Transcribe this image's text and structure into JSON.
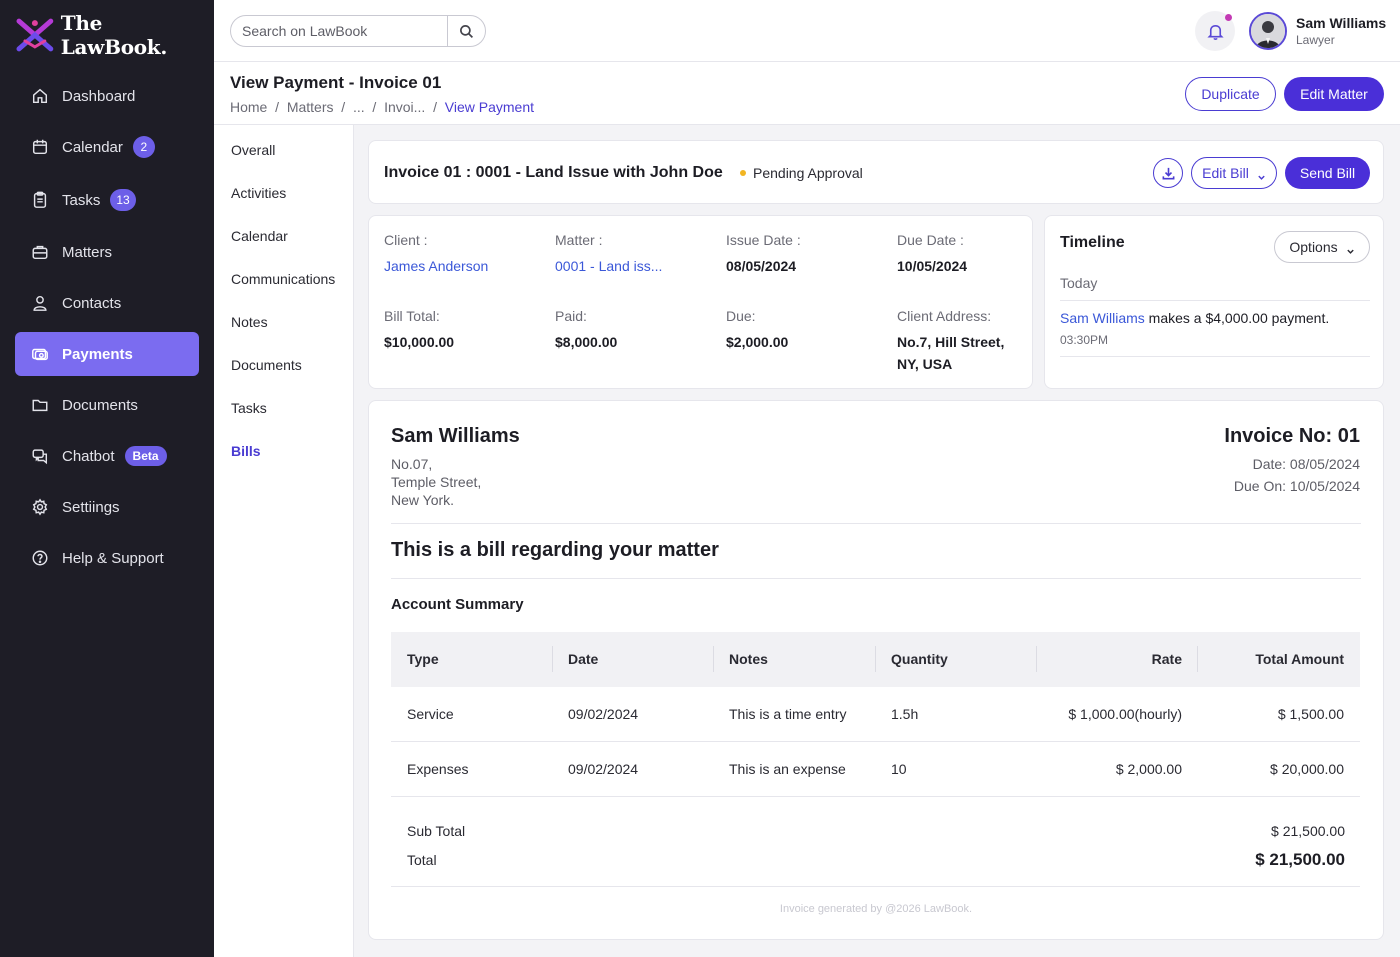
{
  "app": {
    "name": "The LawBook."
  },
  "colors": {
    "accent": "#4a2fd8",
    "sidebar_bg": "#1e1d26",
    "active_nav": "#7b6cf0",
    "link": "#3b58d8",
    "pending": "#f2b522"
  },
  "sidebar": {
    "items": [
      {
        "label": "Dashboard",
        "icon": "home-icon"
      },
      {
        "label": "Calendar",
        "icon": "calendar-icon",
        "badge": "2"
      },
      {
        "label": "Tasks",
        "icon": "clipboard-icon",
        "badge": "13"
      },
      {
        "label": "Matters",
        "icon": "briefcase-icon"
      },
      {
        "label": "Contacts",
        "icon": "user-icon"
      },
      {
        "label": "Payments",
        "icon": "payments-icon",
        "active": true
      },
      {
        "label": "Documents",
        "icon": "folder-icon"
      },
      {
        "label": "Chatbot",
        "icon": "chat-icon",
        "badge": "Beta"
      },
      {
        "label": "Settiings",
        "icon": "gear-icon"
      },
      {
        "label": "Help & Support",
        "icon": "help-icon"
      }
    ]
  },
  "search": {
    "placeholder": "Search on LawBook"
  },
  "user": {
    "name": "Sam Williams",
    "role": "Lawyer"
  },
  "page": {
    "title": "View Payment - Invoice 01",
    "breadcrumb": [
      "Home",
      "Matters",
      "...",
      "Invoi...",
      "View Payment"
    ],
    "duplicate_label": "Duplicate",
    "edit_matter_label": "Edit Matter"
  },
  "subnav": {
    "items": [
      "Overall",
      "Activities",
      "Calendar",
      "Communications",
      "Notes",
      "Documents",
      "Tasks",
      "Bills"
    ],
    "active": "Bills"
  },
  "invoice_header": {
    "title": "Invoice 01 : 0001 - Land Issue with John Doe",
    "status": "Pending Approval",
    "edit_bill_label": "Edit Bill",
    "send_bill_label": "Send Bill"
  },
  "details": {
    "client_label": "Client :",
    "client": "James Anderson",
    "matter_label": "Matter :",
    "matter": "0001 - Land iss...",
    "issue_label": "Issue Date :",
    "issue": "08/05/2024",
    "due_label": "Due Date :",
    "due": "10/05/2024",
    "bill_total_label": "Bill Total:",
    "bill_total": "$10,000.00",
    "paid_label": "Paid:",
    "paid": "$8,000.00",
    "due_amt_label": "Due:",
    "due_amt": "$2,000.00",
    "address_label": "Client Address:",
    "address_line1": "No.7, Hill Street,",
    "address_line2": "NY, USA"
  },
  "timeline": {
    "title": "Timeline",
    "options_label": "Options",
    "group": "Today",
    "entry_who": "Sam Williams",
    "entry_text": " makes a $4,000.00 payment.",
    "entry_time": "03:30PM"
  },
  "invoice": {
    "from_name": "Sam Williams",
    "address": [
      "No.07,",
      "Temple Street,",
      "New York."
    ],
    "number": "Invoice No: 01",
    "date": "Date: 08/05/2024",
    "due_on": "Due On: 10/05/2024",
    "subject": "This is a bill regarding your matter",
    "summary_title": "Account Summary",
    "columns": [
      "Type",
      "Date",
      "Notes",
      "Quantity",
      "Rate",
      "Total Amount"
    ],
    "rows": [
      {
        "type": "Service",
        "date": "09/02/2024",
        "notes": "This is a time entry",
        "quantity": "1.5h",
        "rate": "$ 1,000.00(hourly)",
        "total": "$ 1,500.00"
      },
      {
        "type": "Expenses",
        "date": "09/02/2024",
        "notes": "This is an expense",
        "quantity": "10",
        "rate": "$ 2,000.00",
        "total": "$ 20,000.00"
      }
    ],
    "subtotal_label": "Sub Total",
    "subtotal": "$ 21,500.00",
    "total_label": "Total",
    "total": "$ 21,500.00",
    "footer": "Invoice generated by @2026 LawBook."
  }
}
